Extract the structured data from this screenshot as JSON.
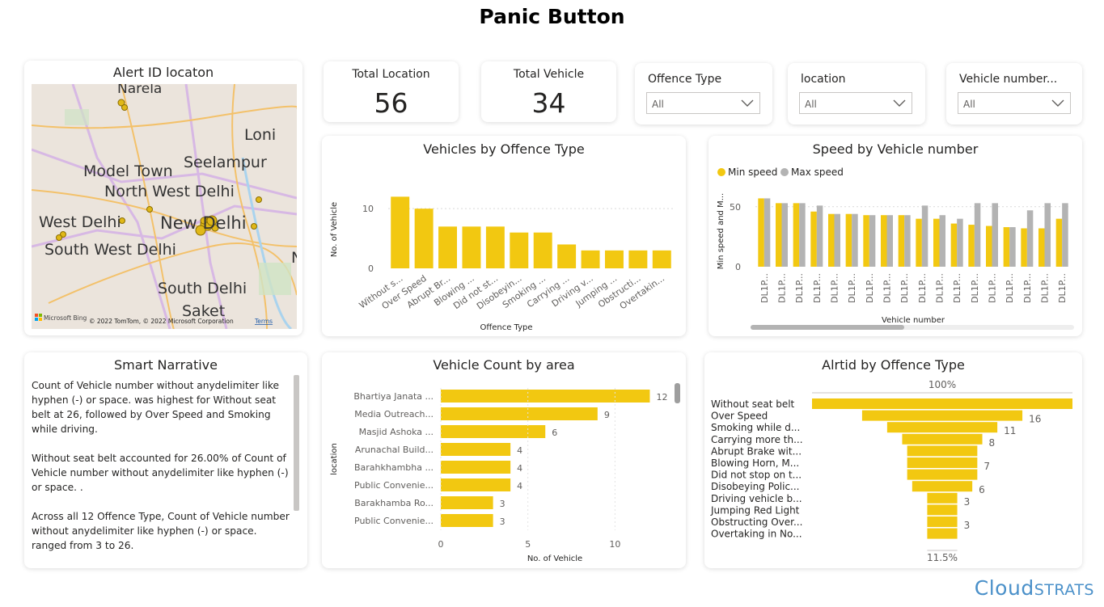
{
  "page": {
    "title": "Panic Button",
    "brand_main": "Cloud",
    "brand_suffix": "STRATS"
  },
  "map": {
    "title": "Alert ID locaton",
    "places": [
      "Narela",
      "Loni",
      "Model Town",
      "Seelampur",
      "North West Delhi",
      "West Delhi",
      "New Delhi",
      "South West Delhi",
      "South Delhi",
      "Saket",
      "N"
    ],
    "attribution": "© 2022 TomTom, © 2022 Microsoft Corporation",
    "terms": "Terms",
    "bing": "Microsoft Bing"
  },
  "kpis": [
    {
      "label": "Total Location",
      "value": "56"
    },
    {
      "label": "Total Vehicle",
      "value": "34"
    }
  ],
  "slicers": [
    {
      "label": "Offence Type",
      "value": "All"
    },
    {
      "label": "location",
      "value": "All"
    },
    {
      "label": "Vehicle number...",
      "value": "All"
    }
  ],
  "narrative": {
    "title": "Smart Narrative",
    "paragraphs": [
      "Count of Vehicle number without anydelimiter like hyphen (-) or space.  was highest for Without seat belt at 26, followed by Over Speed and Smoking while driving.",
      "Without seat belt accounted for 26.00% of Count of Vehicle number without anydelimiter like hyphen (-) or space. .",
      "Across all 12 Offence Type, Count of Vehicle number without anydelimiter like hyphen (-) or space. ranged from 3 to 26."
    ]
  },
  "chart_data": [
    {
      "type": "bar",
      "title": "Vehicles by Offence Type",
      "xlabel": "Offence Type",
      "ylabel": "No. of Vehicle",
      "categories": [
        "Without s...",
        "Over Speed",
        "Abrupt Br...",
        "Blowing ...",
        "Did not st...",
        "Disobeyin...",
        "Smoking ...",
        "Carrying ...",
        "Driving v...",
        "Jumping ...",
        "Obstructi...",
        "Overtakin..."
      ],
      "values": [
        12,
        10,
        7,
        7,
        7,
        6,
        6,
        4,
        3,
        3,
        3,
        3
      ],
      "yticks": [
        "0",
        "10"
      ],
      "ylim": [
        0,
        13
      ],
      "color": "#f2c811"
    },
    {
      "type": "bar",
      "title": "Speed by Vehicle number",
      "xlabel": "Vehicle number",
      "ylabel": "Min speed and M...",
      "legend": [
        "Min speed",
        "Max speed"
      ],
      "categories": [
        "DL1P...",
        "DL1P...",
        "DL1P...",
        "DL1P...",
        "DL1P...",
        "DL1P...",
        "DL1P...",
        "DL1P...",
        "DL1P...",
        "DL1P...",
        "DL1P...",
        "DL1P...",
        "DL1P...",
        "DL1P...",
        "DL1P...",
        "DL1P...",
        "DL1P...",
        "DL1P..."
      ],
      "series": [
        {
          "name": "Min speed",
          "color": "#f2c811",
          "values": [
            57,
            53,
            53,
            46,
            44,
            44,
            43,
            43,
            43,
            40,
            40,
            36,
            35,
            34,
            33,
            32,
            32,
            40
          ]
        },
        {
          "name": "Max speed",
          "color": "#b3b3b3",
          "values": [
            57,
            53,
            53,
            51,
            44,
            44,
            43,
            43,
            43,
            51,
            43,
            40,
            53,
            53,
            33,
            47,
            53,
            53
          ]
        }
      ],
      "yticks": [
        "0",
        "50"
      ],
      "ylim": [
        0,
        62
      ]
    },
    {
      "type": "bar",
      "orientation": "horizontal",
      "title": "Vehicle Count by area",
      "xlabel": "No. of Vehicle",
      "ylabel": "location",
      "categories": [
        "Bhartiya Janata ...",
        "Media Outreach...",
        "Masjid Ashoka ...",
        "Arunachal Build...",
        "Barahkhambha ...",
        "Public Convenie...",
        "Barakhamba Ro...",
        "Public Convenie..."
      ],
      "values": [
        12,
        9,
        6,
        4,
        4,
        4,
        3,
        3
      ],
      "xticks": [
        "0",
        "5",
        "10"
      ],
      "xlim": [
        0,
        13
      ],
      "color": "#f2c811"
    },
    {
      "type": "bar",
      "orientation": "funnel",
      "title": "Alrtid by Offence Type",
      "top_label": "100%",
      "bottom_label": "11.5%",
      "categories": [
        "Without seat belt",
        "Over Speed",
        "Smoking while d...",
        "Carrying more th...",
        "Abrupt Brake wit...",
        "Blowing Horn, M...",
        "Did not stop on t...",
        "Disobeying Polic...",
        "Driving vehicle b...",
        "Jumping Red Light",
        "Obstructing Over...",
        "Overtaking in No..."
      ],
      "values": [
        26,
        16,
        11,
        8,
        7,
        7,
        7,
        6,
        3,
        3,
        3,
        3
      ],
      "value_labels": [
        "",
        "16",
        "11",
        "8",
        "",
        "7",
        "",
        "6",
        "3",
        "",
        "3",
        ""
      ],
      "color": "#f2c811"
    }
  ]
}
